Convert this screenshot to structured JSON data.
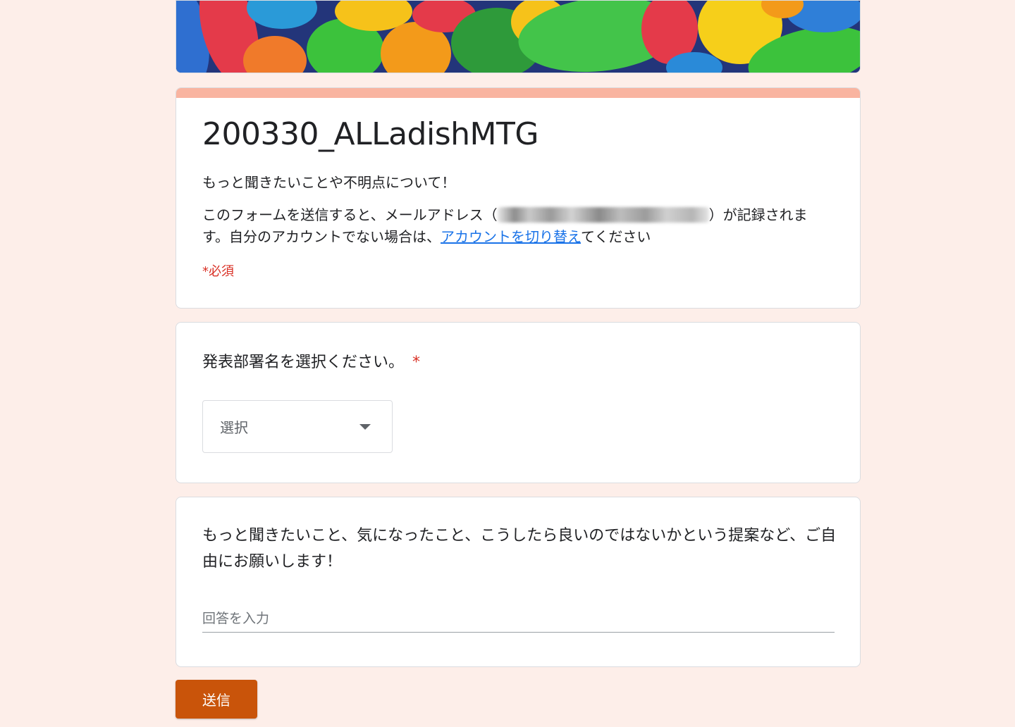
{
  "form": {
    "title": "200330_ALLadishMTG",
    "description": "もっと聞きたいことや不明点について！",
    "email_notice_prefix": "このフォームを送信すると、メールアドレス（",
    "email_notice_suffix": "）が記録されます。自分のアカウントでない場合は、",
    "switch_account_link": "アカウントを切り替え",
    "email_notice_end": "てください",
    "required_note": "*必須"
  },
  "questions": [
    {
      "title": "発表部署名を選択ください。",
      "required_mark": "*",
      "type": "dropdown",
      "selected": "選択"
    },
    {
      "title": "もっと聞きたいこと、気になったこと、こうしたら良いのではないかという提案など、ご自由にお願いします！",
      "type": "text",
      "placeholder": "回答を入力"
    }
  ],
  "submit_label": "送信",
  "colors": {
    "background": "#fdeee9",
    "accent_bar": "#f9b4a0",
    "submit": "#c9540a",
    "link": "#1a73e8",
    "required": "#d93025"
  }
}
